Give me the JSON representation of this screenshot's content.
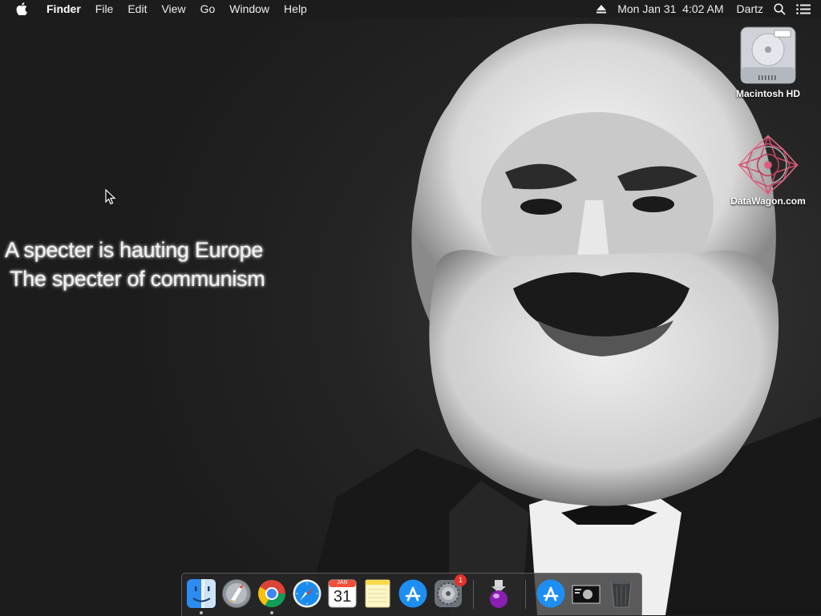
{
  "menubar": {
    "app_name": "Finder",
    "menus": [
      "File",
      "Edit",
      "View",
      "Go",
      "Window",
      "Help"
    ],
    "clock": "Mon Jan 31  4:02 AM",
    "user": "Dartz"
  },
  "desktop": {
    "icons": [
      {
        "label": "Macintosh HD"
      },
      {
        "label": "DataWagon.com"
      }
    ]
  },
  "wallpaper": {
    "quote_line1": "A specter is hauting Europe",
    "quote_line2": "The specter of communism"
  },
  "dock": {
    "apps": [
      "Finder",
      "Launchpad",
      "Google Chrome",
      "Safari",
      "Calendar",
      "Notes",
      "App Store",
      "System Preferences",
      "Installer",
      "App Store",
      "Photo Booth",
      "Trash"
    ],
    "calendar_month": "JAN",
    "calendar_day": "31",
    "sysprefs_badge": "1"
  },
  "colors": {
    "menubar_bg": "#1c1c1c",
    "badge": "#e5332a",
    "appstore_blue": "#1e8ff2"
  }
}
